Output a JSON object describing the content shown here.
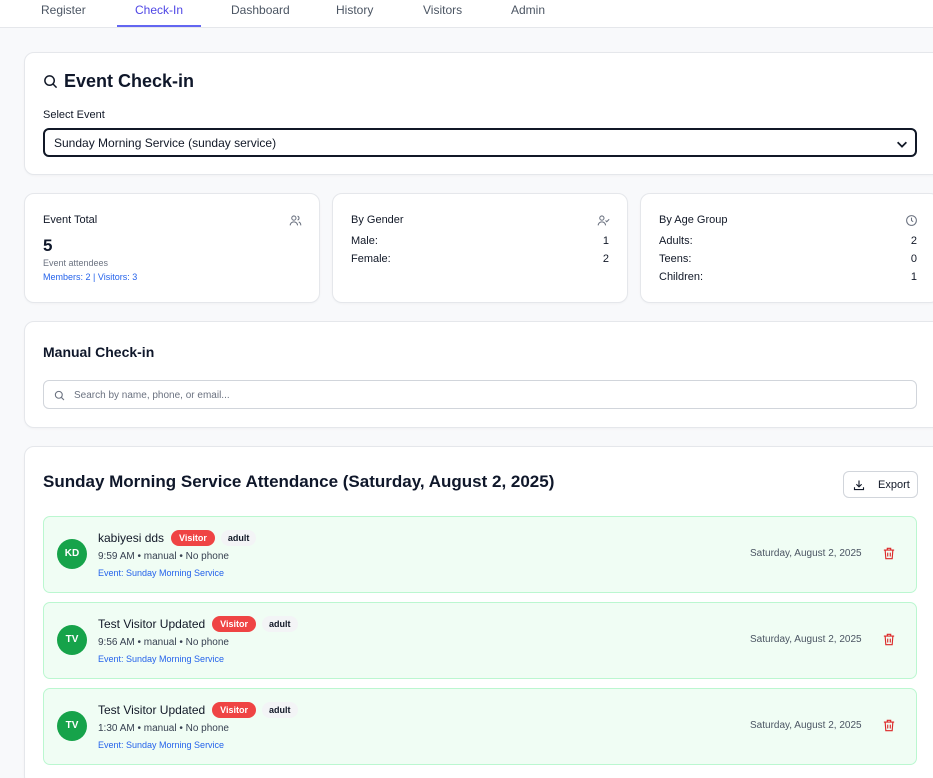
{
  "nav": {
    "tabs": [
      {
        "label": "Register"
      },
      {
        "label": "Check-In"
      },
      {
        "label": "Dashboard"
      },
      {
        "label": "History"
      },
      {
        "label": "Visitors"
      },
      {
        "label": "Admin"
      }
    ],
    "active": "Check-In"
  },
  "event_checkin": {
    "title": "Event Check-in",
    "select_label": "Select Event",
    "selected_event": "Sunday Morning Service (sunday service)"
  },
  "stats": {
    "total": {
      "title": "Event Total",
      "value": "5",
      "caption": "Event attendees",
      "breakdown": "Members: 2 | Visitors: 3"
    },
    "gender": {
      "title": "By Gender",
      "male_label": "Male:",
      "male_value": "1",
      "female_label": "Female:",
      "female_value": "2"
    },
    "age": {
      "title": "By Age Group",
      "adults_label": "Adults:",
      "adults_value": "2",
      "teens_label": "Teens:",
      "teens_value": "0",
      "children_label": "Children:",
      "children_value": "1"
    }
  },
  "manual": {
    "title": "Manual Check-in",
    "search_placeholder": "Search by name, phone, or email..."
  },
  "attendance": {
    "title": "Sunday Morning Service Attendance (Saturday, August 2, 2025)",
    "export_label": "Export",
    "rows": [
      {
        "initials": "KD",
        "name": "kabiyesi dds",
        "badge": "Visitor",
        "age": "adult",
        "meta": "9:59 AM • manual • No phone",
        "event": "Event: Sunday Morning Service",
        "date": "Saturday, August 2, 2025"
      },
      {
        "initials": "TV",
        "name": "Test Visitor Updated",
        "badge": "Visitor",
        "age": "adult",
        "meta": "9:56 AM • manual • No phone",
        "event": "Event: Sunday Morning Service",
        "date": "Saturday, August 2, 2025"
      },
      {
        "initials": "TV",
        "name": "Test Visitor Updated",
        "badge": "Visitor",
        "age": "adult",
        "meta": "1:30 AM • manual • No phone",
        "event": "Event: Sunday Morning Service",
        "date": "Saturday, August 2, 2025"
      }
    ]
  },
  "colors": {
    "accent": "#4f46e5",
    "success": "#16a34a",
    "danger": "#ef4444",
    "link": "#2563eb"
  },
  "icons": {
    "title": "search-icon",
    "select": "chevron-down-icon",
    "total": "users-icon",
    "gender": "user-check-icon",
    "age": "clock-icon",
    "search": "search-icon",
    "export": "download-icon",
    "row_action": "trash-icon"
  }
}
